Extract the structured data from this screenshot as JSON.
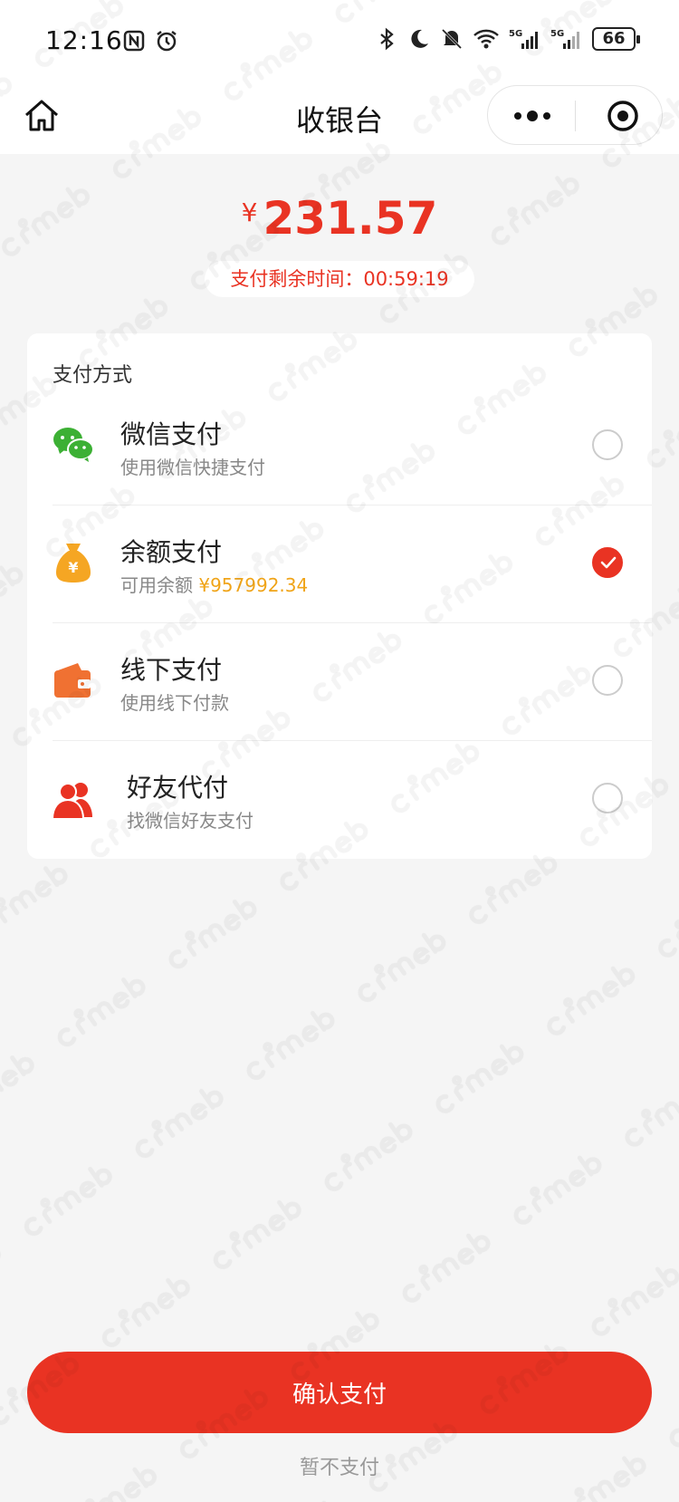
{
  "status_bar": {
    "time": "12:16",
    "battery": "66"
  },
  "nav": {
    "title": "收银台"
  },
  "payment": {
    "currency_symbol": "¥",
    "amount": "231.57",
    "timer_label": "支付剩余时间：",
    "timer_value": "00:59:19"
  },
  "methods": {
    "title": "支付方式",
    "items": [
      {
        "name": "微信支付",
        "desc": "使用微信快捷支付",
        "selected": false,
        "icon": "wechat-icon",
        "color": "#3cb034"
      },
      {
        "name": "余额支付",
        "desc": "可用余额",
        "balance": "¥957992.34",
        "selected": true,
        "icon": "money-bag-icon",
        "color": "#f5a623"
      },
      {
        "name": "线下支付",
        "desc": "使用线下付款",
        "selected": false,
        "icon": "wallet-icon",
        "color": "#f07132"
      },
      {
        "name": "好友代付",
        "desc": "找微信好友支付",
        "selected": false,
        "icon": "friends-icon",
        "color": "#e93323"
      }
    ]
  },
  "actions": {
    "confirm": "确认支付",
    "skip": "暂不支付"
  },
  "colors": {
    "accent": "#e93323",
    "balance": "#f0a418",
    "background": "#f5f5f5"
  }
}
